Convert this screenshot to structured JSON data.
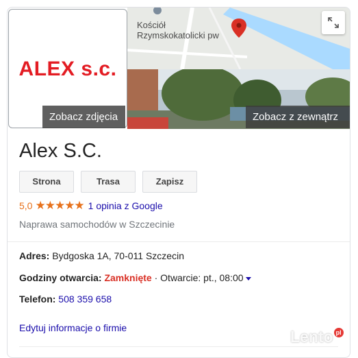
{
  "media": {
    "logo_text": "ALEX s.c.",
    "see_photos_label": "Zobacz zdjęcia",
    "see_outside_label": "Zobacz z zewnątrz",
    "map_place_label_line1": "Kościół",
    "map_place_label_line2": "Rzymskokatolicki pw",
    "expand_icon": "expand-arrows-icon"
  },
  "business": {
    "name": "Alex S.C.",
    "buttons": {
      "website": "Strona",
      "route": "Trasa",
      "save": "Zapisz"
    },
    "rating": {
      "score": "5,0",
      "stars": "★★★★★",
      "reviews_link": "1 opinia z Google"
    },
    "category": "Naprawa samochodów w Szczecinie"
  },
  "details": {
    "address_label": "Adres:",
    "address_value": "Bydgoska 1A, 70-011 Szczecin",
    "hours_label": "Godziny otwarcia:",
    "hours_status": "Zamknięte",
    "hours_next": "· Otwarcie: pt., 08:00",
    "phone_label": "Telefon:",
    "phone_value": "508 359 658",
    "edit_link": "Edytuj informacje o firmie"
  },
  "watermark": {
    "text": "Lento",
    "badge": "pl"
  },
  "colors": {
    "logo_red": "#e31c23",
    "star_orange": "#e7711b",
    "link_blue": "#1a0dab",
    "closed_red": "#d93025",
    "map_pin": "#d93025",
    "map_water": "#aadaff"
  }
}
